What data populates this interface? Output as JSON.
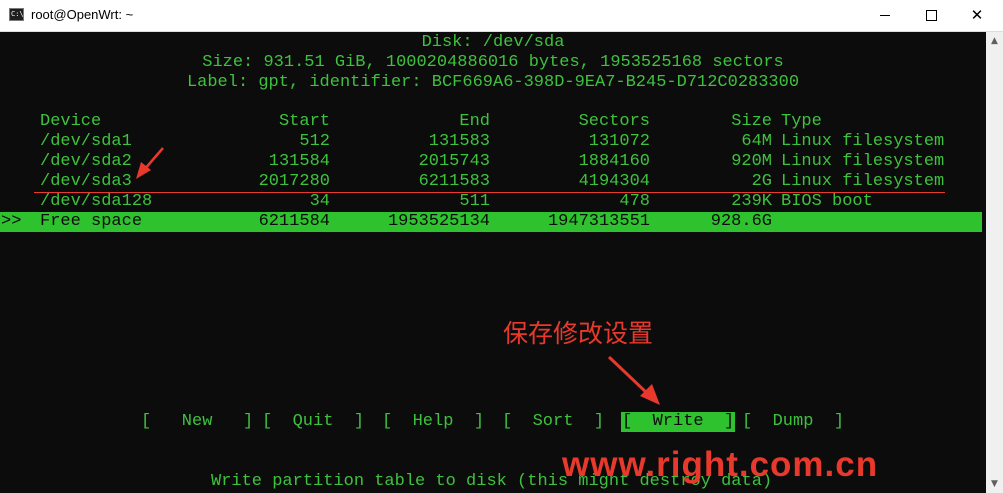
{
  "window": {
    "title": "root@OpenWrt: ~",
    "icon": "terminal-icon",
    "minimize_glyph": "",
    "close_glyph": "✕"
  },
  "disk_info": {
    "line1": "Disk: /dev/sda",
    "line2": "Size: 931.51 GiB, 1000204886016 bytes, 1953525168 sectors",
    "line3": "Label: gpt, identifier: BCF669A6-398D-9EA7-B245-D712C0283300"
  },
  "table": {
    "headers": {
      "device": "Device",
      "start": "Start",
      "end": "End",
      "sectors": "Sectors",
      "size": "Size",
      "type": "Type"
    },
    "rows": [
      {
        "device": "/dev/sda1",
        "start": "512",
        "end": "131583",
        "sectors": "131072",
        "size": "64M",
        "type": "Linux filesystem"
      },
      {
        "device": "/dev/sda2",
        "start": "131584",
        "end": "2015743",
        "sectors": "1884160",
        "size": "920M",
        "type": "Linux filesystem"
      },
      {
        "device": "/dev/sda3",
        "start": "2017280",
        "end": "6211583",
        "sectors": "4194304",
        "size": "2G",
        "type": "Linux filesystem"
      },
      {
        "device": "/dev/sda128",
        "start": "34",
        "end": "511",
        "sectors": "478",
        "size": "239K",
        "type": "BIOS boot"
      }
    ],
    "selected": {
      "marker": ">>",
      "device": "Free space",
      "start": "6211584",
      "end": "1953525134",
      "sectors": "1947313551",
      "size": "928.6G",
      "type": ""
    }
  },
  "menu": [
    {
      "label": "[   New   ]"
    },
    {
      "label": "[  Quit  ]"
    },
    {
      "label": "[  Help  ]"
    },
    {
      "label": "[  Sort  ]"
    },
    {
      "label": "[  Write  ]"
    },
    {
      "label": "[  Dump  ]"
    }
  ],
  "status": "Write partition table to disk (this might destroy data)",
  "annotation": "保存修改设置",
  "watermark": "www.right.com.cn",
  "colors": {
    "terminal_fg": "#3ec23e",
    "terminal_bg": "#0c0c0c",
    "highlight_bg": "#2fc22f",
    "annotation_red": "#e8392c"
  }
}
